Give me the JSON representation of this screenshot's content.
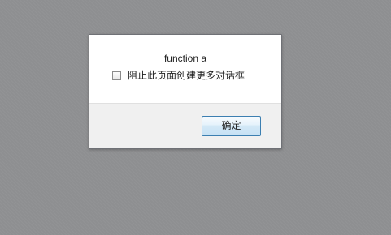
{
  "dialog": {
    "message": "function a",
    "checkbox_label": "阻止此页面创建更多对话框",
    "checkbox_checked": false,
    "ok_label": "确定"
  },
  "colors": {
    "overlay": "#8e8f91",
    "dialog_background": "#ffffff",
    "footer_background": "#f0f0f0",
    "button_border": "#3c7fb1"
  },
  "icons": {
    "checkbox": "checkbox-unchecked-icon"
  }
}
